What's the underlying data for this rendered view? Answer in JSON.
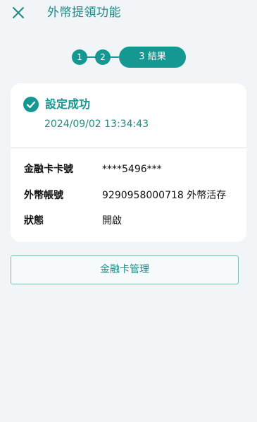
{
  "header": {
    "title": "外幣提領功能",
    "close_icon": "close-icon"
  },
  "stepper": {
    "step1": "1",
    "step2": "2",
    "step3": "3 結果",
    "current_step": 3,
    "color": "#159891"
  },
  "result": {
    "status_icon": "check-circle-icon",
    "title": "設定成功",
    "datetime": "2024/09/02 13:34:43"
  },
  "details": [
    {
      "label": "金融卡卡號",
      "value": "****5496***"
    },
    {
      "label": "外幣帳號",
      "value": "9290958000718 外幣活存"
    },
    {
      "label": "狀態",
      "value": "開啟"
    }
  ],
  "actions": {
    "manage_label": "金融卡管理"
  },
  "colors": {
    "accent": "#159891",
    "background": "#f1f5f8",
    "card": "#ffffff"
  }
}
